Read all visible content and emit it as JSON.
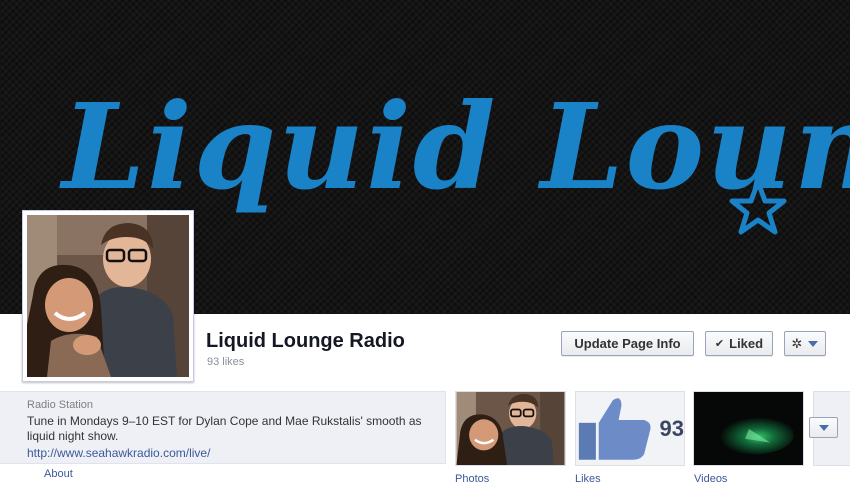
{
  "cover": {
    "title": "Liquid Lounge",
    "brand_color": "#1a82c7",
    "star_icon": "star-outline-icon"
  },
  "profile": {
    "page_name": "Liquid Lounge Radio",
    "likes_text": "93 likes"
  },
  "actions": {
    "update_label": "Update Page Info",
    "liked_label": "Liked",
    "liked_icon": "check-icon",
    "settings_icon": "gear-icon",
    "dropdown_icon": "chevron-down-icon"
  },
  "about": {
    "category": "Radio Station",
    "description": "Tune in Mondays 9–10 EST for Dylan Cope and Mae Rukstalis' smooth as liquid night show.",
    "link": "http://www.seahawkradio.com/live/",
    "section_label": "About"
  },
  "apps": {
    "photos_label": "Photos",
    "likes_label": "Likes",
    "likes_number": "93",
    "videos_label": "Videos",
    "more_icon": "chevron-down-icon"
  },
  "colors": {
    "link": "#3b5998",
    "accent": "#1a82c7",
    "cover_bg": "#141414"
  }
}
